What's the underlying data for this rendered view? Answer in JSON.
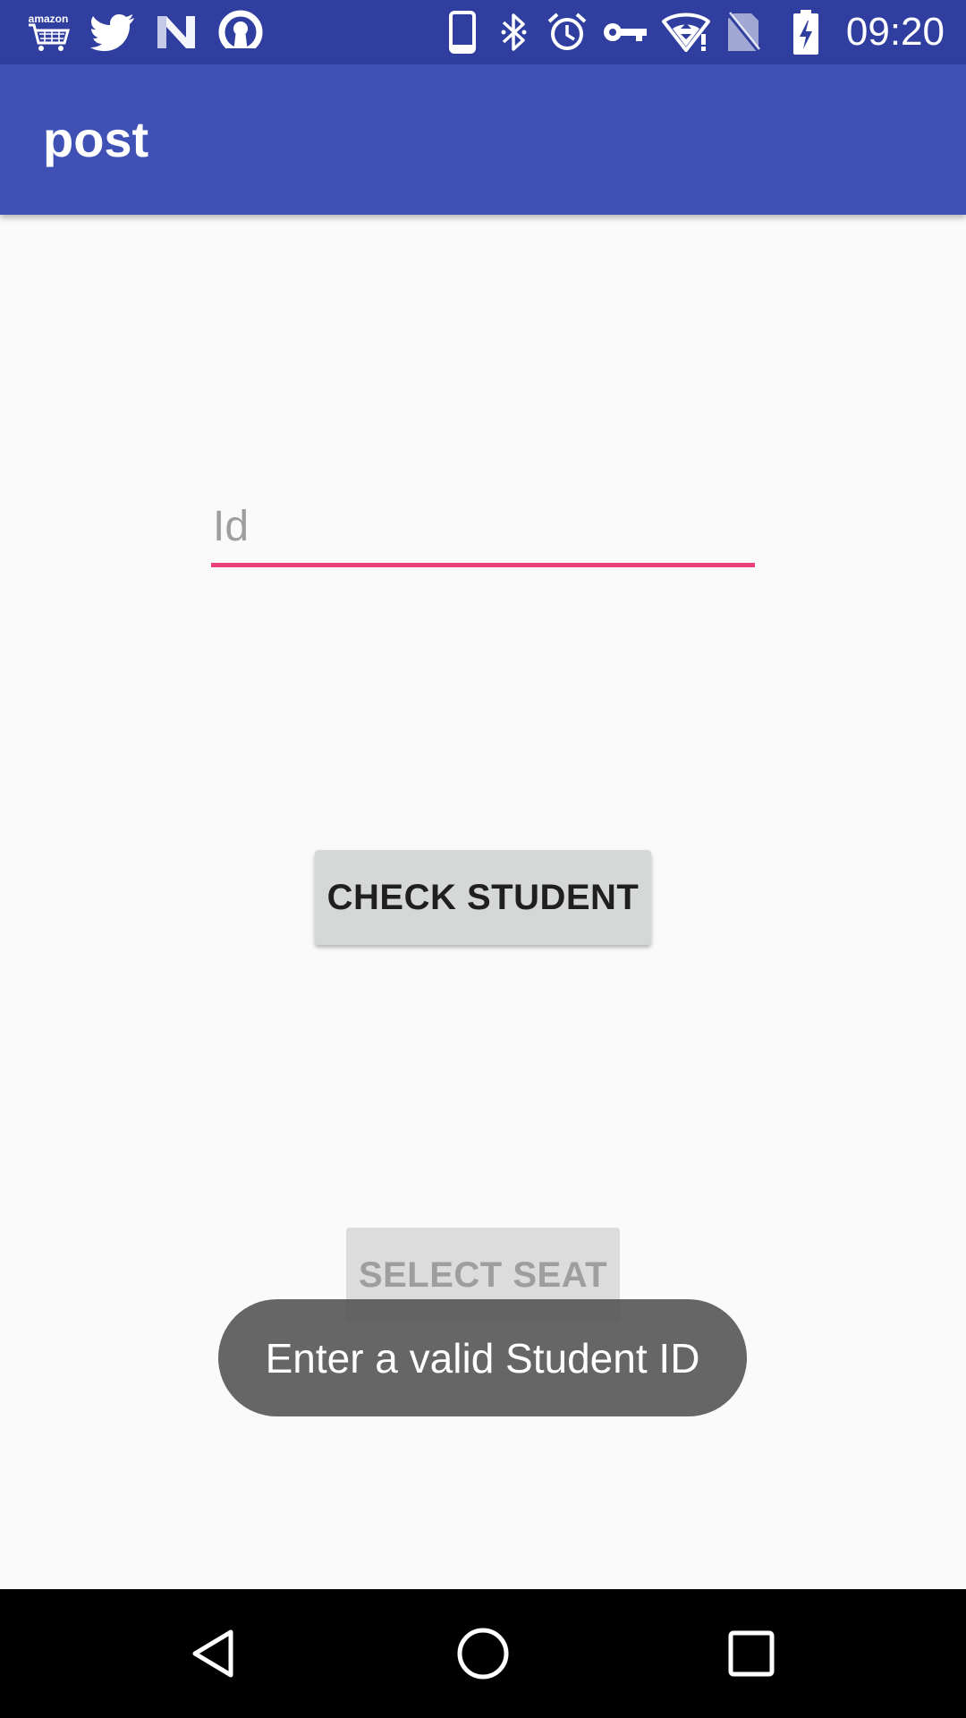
{
  "status_bar": {
    "left_icons": [
      "amazon-shopping-icon",
      "twitter-icon",
      "nova-launcher-icon",
      "openvpn-icon"
    ],
    "right_icons": [
      "phone-icon",
      "bluetooth-icon",
      "alarm-icon",
      "vpn-key-icon",
      "wifi-icon",
      "no-sim-icon",
      "battery-charging-icon"
    ],
    "amazon_label": "amazon",
    "time": "09:20",
    "color": "#303f9f"
  },
  "app_bar": {
    "title": "post",
    "color": "#3f51b5"
  },
  "form": {
    "id_placeholder": "Id",
    "id_value": "",
    "underline_color": "#ec407a"
  },
  "buttons": {
    "check_student": "CHECK STUDENT",
    "select_seat": "SELECT SEAT",
    "select_seat_enabled": false
  },
  "toast": {
    "message": "Enter a valid Student ID"
  },
  "nav_bar": {
    "buttons": [
      "back-icon",
      "home-icon",
      "recents-icon"
    ]
  }
}
